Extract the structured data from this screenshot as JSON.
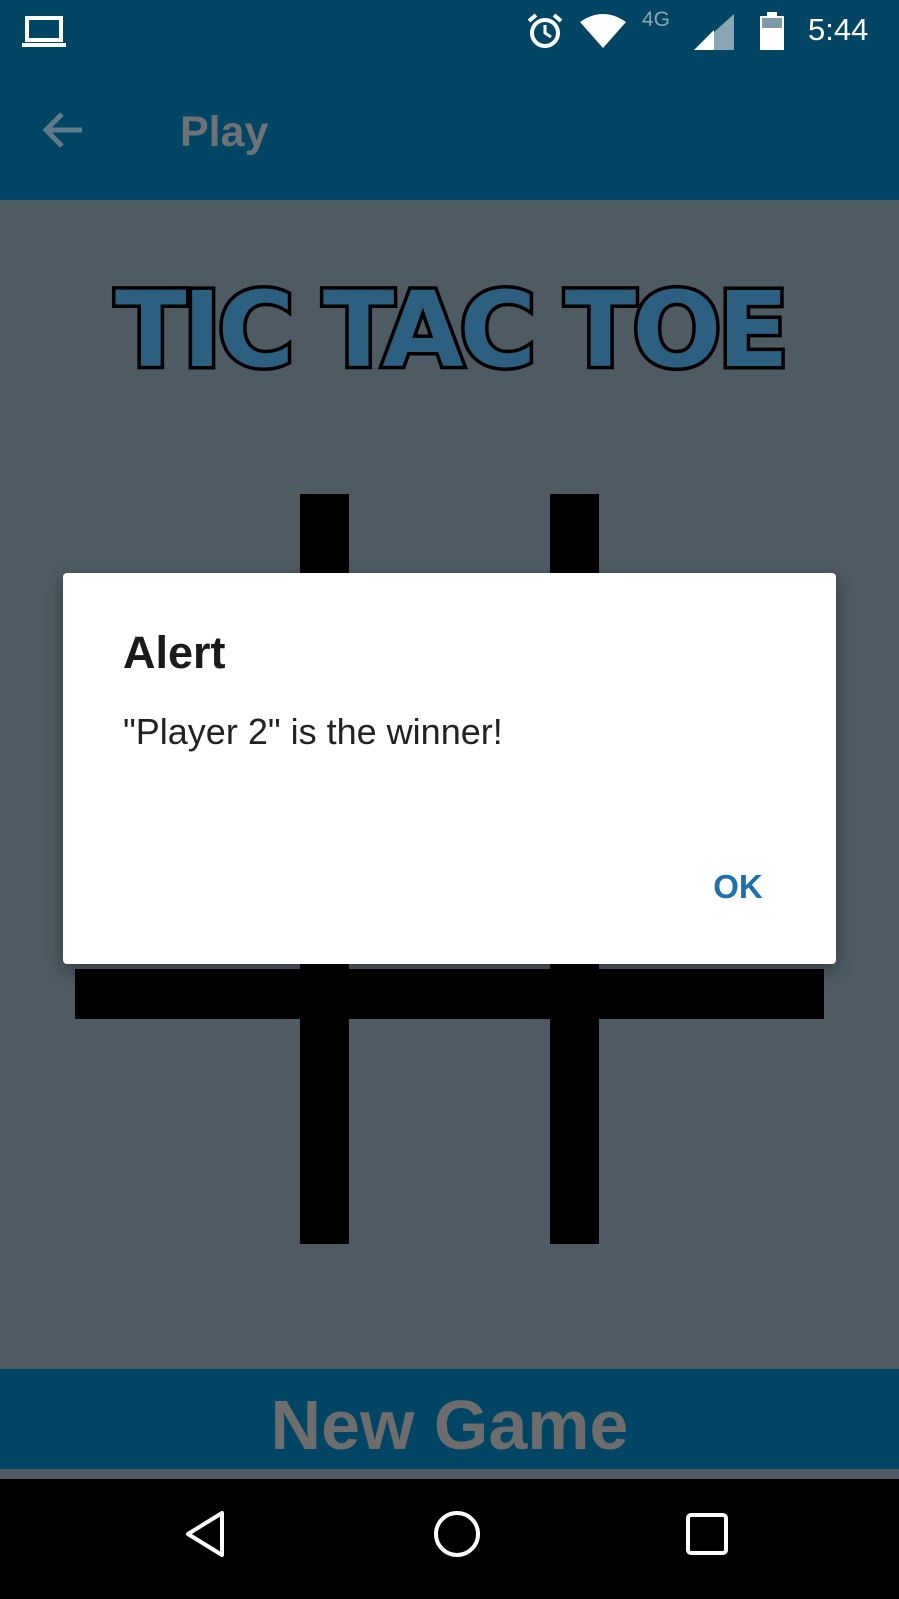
{
  "status_bar": {
    "network_type": "4G",
    "time": "5:44",
    "icons": [
      "laptop-icon",
      "alarm-icon",
      "wifi-icon",
      "signal-icon",
      "battery-icon"
    ]
  },
  "app_bar": {
    "title": "Play",
    "back_icon": "arrow-back-icon"
  },
  "logo": {
    "text": "TIC TAC TOE"
  },
  "dialog": {
    "title": "Alert",
    "message": "\"Player 2\" is the winner!",
    "ok_label": "OK"
  },
  "new_game": {
    "label": "New Game"
  },
  "nav_bar": {
    "icons": [
      "nav-back-icon",
      "nav-home-icon",
      "nav-recents-icon"
    ]
  },
  "colors": {
    "primary_dark": "#004563",
    "dim_background": "#4e5b63",
    "accent": "#1f6fa8",
    "logo_blue": "#2f78ad"
  }
}
